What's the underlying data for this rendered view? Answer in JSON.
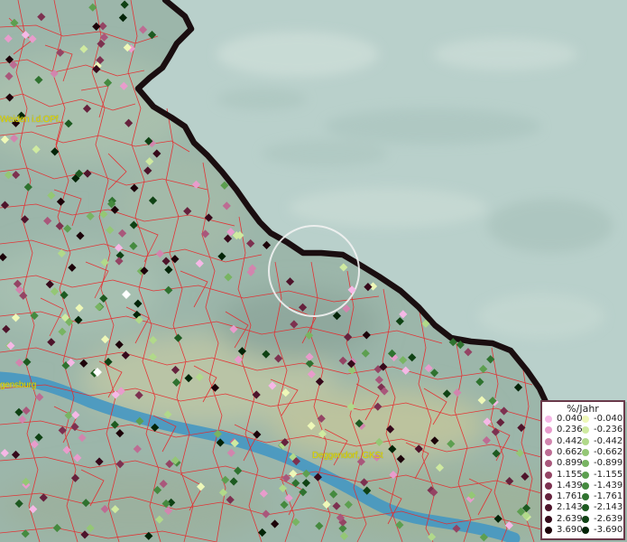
{
  "legend": {
    "title": "%/Jahr",
    "positive": [
      {
        "label": "0.040",
        "color": "#f5b8e6"
      },
      {
        "label": "0.236",
        "color": "#e89ccc"
      },
      {
        "label": "0.442",
        "color": "#d285ae"
      },
      {
        "label": "0.662",
        "color": "#bd6c93"
      },
      {
        "label": "0.899",
        "color": "#a9577b"
      },
      {
        "label": "1.155",
        "color": "#944464"
      },
      {
        "label": "1.439",
        "color": "#7d3150"
      },
      {
        "label": "1.761",
        "color": "#66223d"
      },
      {
        "label": "2.143",
        "color": "#4e142b"
      },
      {
        "label": "2.639",
        "color": "#36091b"
      },
      {
        "label": "3.690",
        "color": "#1c0209"
      }
    ],
    "negative": [
      {
        "label": "-0.040",
        "color": "#eef8b8"
      },
      {
        "label": "-0.236",
        "color": "#cfeaa0"
      },
      {
        "label": "-0.442",
        "color": "#b1d98a"
      },
      {
        "label": "-0.662",
        "color": "#94c775"
      },
      {
        "label": "-0.899",
        "color": "#78b462"
      },
      {
        "label": "-1.155",
        "color": "#5d9f50"
      },
      {
        "label": "-1.439",
        "color": "#458a3f"
      },
      {
        "label": "-1.761",
        "color": "#2f722f"
      },
      {
        "label": "-2.143",
        "color": "#1d5a20"
      },
      {
        "label": "-2.639",
        "color": "#0f4214"
      },
      {
        "label": "-3.690",
        "color": "#032408"
      }
    ]
  },
  "places": {
    "weiden": "Weiden i.d.OPf.",
    "regensburg": "gensburg",
    "deggendorf": "Deggendorf, GKSt"
  },
  "colors": {
    "border": "#1a0e10",
    "admin_lines": "#e8272a",
    "river": "#3f95c4",
    "highlight_circle": "#f2f2f2"
  }
}
